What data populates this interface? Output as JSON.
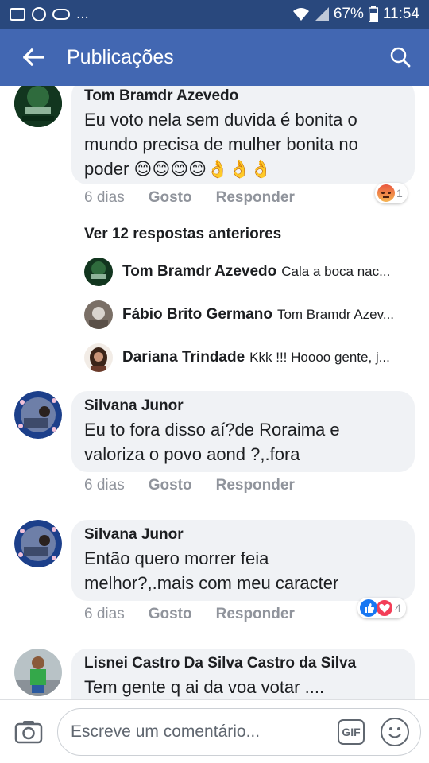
{
  "status": {
    "battery": "67%",
    "time": "11:54",
    "dots": "..."
  },
  "header": {
    "title": "Publicações"
  },
  "colors": {
    "header": "#4267b2",
    "statusbar": "#29487d",
    "bubble": "#f0f2f5",
    "angry": "#f0783c",
    "like": "#1877f2",
    "love": "#f33e58"
  },
  "comments": [
    {
      "name": "Tom Bramdr Azevedo",
      "lines": [
        "Eu voto nela sem duvida é bonita o",
        "mundo precisa de mulher bonita no",
        "poder 😊😊😊😊👌👌👌"
      ],
      "time": "6 dias",
      "like": "Gosto",
      "reply": "Responder",
      "reaction_count": "1",
      "reaction_icons": [
        "angry-icon"
      ]
    },
    {
      "name": "Silvana Junor",
      "lines": [
        "Eu to fora disso aí?de Roraima e",
        "valoriza o povo aond ?,.fora"
      ],
      "time": "6 dias",
      "like": "Gosto",
      "reply": "Responder"
    },
    {
      "name": "Silvana Junor",
      "lines": [
        "Então quero morrer feia",
        "melhor?,.mais com meu caracter"
      ],
      "time": "6 dias",
      "like": "Gosto",
      "reply": "Responder",
      "reaction_count": "4",
      "reaction_icons": [
        "like-icon",
        "love-icon"
      ]
    },
    {
      "name": "Lisnei Castro Da Silva Castro da Silva",
      "lines": [
        "Tem gente q ai da voa votar ...."
      ]
    }
  ],
  "replies": {
    "more_label": "Ver 12 respostas anteriores",
    "items": [
      {
        "name": "Tom Bramdr Azevedo",
        "text": "Cala a boca nac..."
      },
      {
        "name": "Fábio Brito Germano",
        "text": "Tom Bramdr Azev..."
      },
      {
        "name": "Dariana Trindade",
        "text": "Kkk !!! Hoooo gente, j..."
      }
    ]
  },
  "composer": {
    "placeholder": "Escreve um comentário...",
    "gif_label": "GIF"
  }
}
